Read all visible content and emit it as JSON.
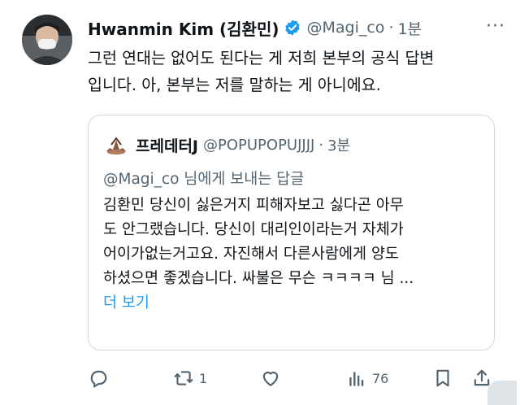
{
  "tweet": {
    "author_name": "Hwanmin Kim (김환민)",
    "handle": "@Magi_co",
    "separator": "·",
    "time": "1분",
    "more": "···",
    "lines": [
      "그런 연대는 없어도 된다는 게 저희 본부의 공식 답변",
      "입니다. 아, 본부는 저를 말하는 게 아니에요."
    ]
  },
  "quoted": {
    "author_name": "프레데터J",
    "handle": "@POPUPOPUJJJJ",
    "separator": "·",
    "time": "3분",
    "reply_mention": "@Magi_co",
    "reply_rest": " 님에게 보내는 답글",
    "lines": [
      "김환민 당신이 싫은거지 피해자보고 싫다곤 아무",
      "도 안그랬습니다. 당신이 대리인이라는거 자체가",
      "어이가없는거고요. 자진해서 다른사람에게 양도",
      "하셨으면 좋겠습니다. 싸불은 무슨 ㅋㅋㅋㅋ 님 ..."
    ],
    "show_more": "더 보기"
  },
  "actions": {
    "reply_count": "",
    "retweet_count": "1",
    "like_count": "",
    "views_count": "76"
  },
  "colors": {
    "accent": "#1d9bf0",
    "secondary_text": "#536471",
    "border": "#cfd9de"
  }
}
